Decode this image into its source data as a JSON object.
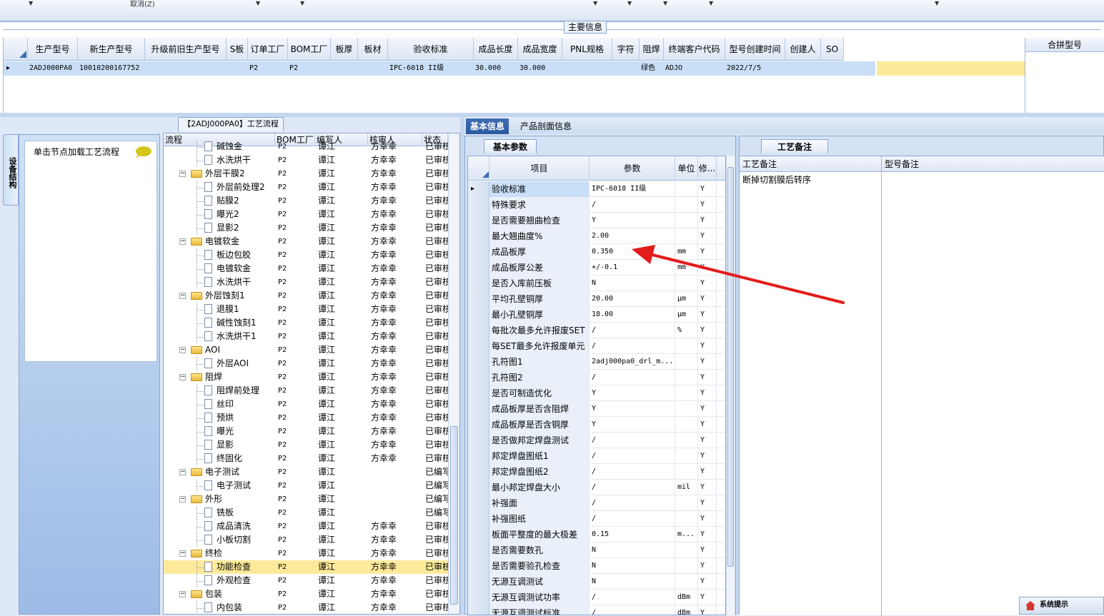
{
  "toolbar": {
    "cancel_label": "取消(Z)"
  },
  "main_info": {
    "title": "主要信息",
    "columns": [
      "生产型号",
      "新生产型号",
      "升级前旧生产型号",
      "S板",
      "订单工厂",
      "BOM工厂",
      "板厚",
      "板材",
      "验收标准",
      "成品长度",
      "成品宽度",
      "PNL规格",
      "字符",
      "阻焊",
      "终端客户代码",
      "型号创建时间",
      "创建人",
      "SO"
    ],
    "row": [
      "2ADJ000PA0",
      "10010200167752",
      "",
      "",
      "P2",
      "P2",
      "",
      "",
      "IPC-6018 II级",
      "30.000",
      "30.000",
      "",
      "",
      "绿色",
      "ADJO",
      "2022/7/5",
      "",
      ""
    ],
    "merge_header": "合拼型号"
  },
  "left_panel": {
    "tab_label": "设备结构",
    "load_text": "单击节点加载工艺流程"
  },
  "flow": {
    "title": "【2ADJ000PA0】工艺流程",
    "columns": [
      "流程",
      "BOM工厂",
      "编写人",
      "核审人",
      "状态"
    ],
    "rows": [
      {
        "name": "碱蚀金",
        "level": 2,
        "type": "doc",
        "bom": "P2",
        "writer": "谭江",
        "reviewer": "方幸幸",
        "status": "已审核"
      },
      {
        "name": "水洗烘干",
        "level": 2,
        "type": "doc",
        "bom": "P2",
        "writer": "谭江",
        "reviewer": "方幸幸",
        "status": "已审核"
      },
      {
        "name": "外层干膜2",
        "level": 1,
        "type": "folder",
        "bom": "P2",
        "writer": "谭江",
        "reviewer": "方幸幸",
        "status": "已审核"
      },
      {
        "name": "外层前处理2",
        "level": 2,
        "type": "doc",
        "bom": "P2",
        "writer": "谭江",
        "reviewer": "方幸幸",
        "status": "已审核"
      },
      {
        "name": "贴膜2",
        "level": 2,
        "type": "doc",
        "bom": "P2",
        "writer": "谭江",
        "reviewer": "方幸幸",
        "status": "已审核"
      },
      {
        "name": "曝光2",
        "level": 2,
        "type": "doc",
        "bom": "P2",
        "writer": "谭江",
        "reviewer": "方幸幸",
        "status": "已审核"
      },
      {
        "name": "显影2",
        "level": 2,
        "type": "doc",
        "bom": "P2",
        "writer": "谭江",
        "reviewer": "方幸幸",
        "status": "已审核"
      },
      {
        "name": "电镀软金",
        "level": 1,
        "type": "folder",
        "bom": "P2",
        "writer": "谭江",
        "reviewer": "方幸幸",
        "status": "已审核"
      },
      {
        "name": "板边包胶",
        "level": 2,
        "type": "doc",
        "bom": "P2",
        "writer": "谭江",
        "reviewer": "方幸幸",
        "status": "已审核"
      },
      {
        "name": "电镀软金",
        "level": 2,
        "type": "doc",
        "bom": "P2",
        "writer": "谭江",
        "reviewer": "方幸幸",
        "status": "已审核"
      },
      {
        "name": "水洗烘干",
        "level": 2,
        "type": "doc",
        "bom": "P2",
        "writer": "谭江",
        "reviewer": "方幸幸",
        "status": "已审核"
      },
      {
        "name": "外层蚀刻1",
        "level": 1,
        "type": "folder",
        "bom": "P2",
        "writer": "谭江",
        "reviewer": "方幸幸",
        "status": "已审核"
      },
      {
        "name": "退膜1",
        "level": 2,
        "type": "doc",
        "bom": "P2",
        "writer": "谭江",
        "reviewer": "方幸幸",
        "status": "已审核"
      },
      {
        "name": "碱性蚀刻1",
        "level": 2,
        "type": "doc",
        "bom": "P2",
        "writer": "谭江",
        "reviewer": "方幸幸",
        "status": "已审核"
      },
      {
        "name": "水洗烘干1",
        "level": 2,
        "type": "doc",
        "bom": "P2",
        "writer": "谭江",
        "reviewer": "方幸幸",
        "status": "已审核"
      },
      {
        "name": "AOI",
        "level": 1,
        "type": "folder",
        "bom": "P2",
        "writer": "谭江",
        "reviewer": "方幸幸",
        "status": "已审核"
      },
      {
        "name": "外层AOI",
        "level": 2,
        "type": "doc",
        "bom": "P2",
        "writer": "谭江",
        "reviewer": "方幸幸",
        "status": "已审核"
      },
      {
        "name": "阻焊",
        "level": 1,
        "type": "folder",
        "bom": "P2",
        "writer": "谭江",
        "reviewer": "方幸幸",
        "status": "已审核"
      },
      {
        "name": "阻焊前处理",
        "level": 2,
        "type": "doc",
        "bom": "P2",
        "writer": "谭江",
        "reviewer": "方幸幸",
        "status": "已审核"
      },
      {
        "name": "丝印",
        "level": 2,
        "type": "doc",
        "bom": "P2",
        "writer": "谭江",
        "reviewer": "方幸幸",
        "status": "已审核"
      },
      {
        "name": "预烘",
        "level": 2,
        "type": "doc",
        "bom": "P2",
        "writer": "谭江",
        "reviewer": "方幸幸",
        "status": "已审核"
      },
      {
        "name": "曝光",
        "level": 2,
        "type": "doc",
        "bom": "P2",
        "writer": "谭江",
        "reviewer": "方幸幸",
        "status": "已审核"
      },
      {
        "name": "显影",
        "level": 2,
        "type": "doc",
        "bom": "P2",
        "writer": "谭江",
        "reviewer": "方幸幸",
        "status": "已审核"
      },
      {
        "name": "终固化",
        "level": 2,
        "type": "doc",
        "bom": "P2",
        "writer": "谭江",
        "reviewer": "方幸幸",
        "status": "已审核"
      },
      {
        "name": "电子测试",
        "level": 1,
        "type": "folder",
        "bom": "P2",
        "writer": "谭江",
        "reviewer": "",
        "status": "已编写"
      },
      {
        "name": "电子测试",
        "level": 2,
        "type": "doc",
        "bom": "P2",
        "writer": "谭江",
        "reviewer": "",
        "status": "已编写"
      },
      {
        "name": "外形",
        "level": 1,
        "type": "folder",
        "bom": "P2",
        "writer": "谭江",
        "reviewer": "",
        "status": "已编写"
      },
      {
        "name": "铣板",
        "level": 2,
        "type": "doc",
        "bom": "P2",
        "writer": "谭江",
        "reviewer": "",
        "status": "已编写"
      },
      {
        "name": "成品清洗",
        "level": 2,
        "type": "doc",
        "bom": "P2",
        "writer": "谭江",
        "reviewer": "方幸幸",
        "status": "已审核"
      },
      {
        "name": "小板切割",
        "level": 2,
        "type": "doc",
        "bom": "P2",
        "writer": "谭江",
        "reviewer": "方幸幸",
        "status": "已审核"
      },
      {
        "name": "终检",
        "level": 1,
        "type": "folder",
        "bom": "P2",
        "writer": "谭江",
        "reviewer": "方幸幸",
        "status": "已审核"
      },
      {
        "name": "功能检查",
        "level": 2,
        "type": "doc",
        "bom": "P2",
        "writer": "谭江",
        "reviewer": "方幸幸",
        "status": "已审核",
        "selected": true
      },
      {
        "name": "外观检查",
        "level": 2,
        "type": "doc",
        "bom": "P2",
        "writer": "谭江",
        "reviewer": "方幸幸",
        "status": "已审核"
      },
      {
        "name": "包装",
        "level": 1,
        "type": "folder",
        "bom": "P2",
        "writer": "谭江",
        "reviewer": "方幸幸",
        "status": "已审核"
      },
      {
        "name": "内包装",
        "level": 2,
        "type": "doc",
        "bom": "P2",
        "writer": "谭江",
        "reviewer": "方幸幸",
        "status": "已审核"
      }
    ]
  },
  "right_tabs": [
    "基本信息",
    "产品剖面信息"
  ],
  "basic": {
    "tab": "基本参数",
    "columns": [
      "项目",
      "参数",
      "单位",
      "修..."
    ],
    "rows": [
      {
        "item": "验收标准",
        "value": "IPC-6018 II级",
        "unit": "",
        "mod": "Y",
        "selected": true
      },
      {
        "item": "特殊要求",
        "value": "/",
        "unit": "",
        "mod": "Y"
      },
      {
        "item": "是否需要翘曲检查",
        "value": "Y",
        "unit": "",
        "mod": "Y"
      },
      {
        "item": "最大翘曲度%",
        "value": "2.00",
        "unit": "",
        "mod": "Y"
      },
      {
        "item": "成品板厚",
        "value": "0.350",
        "unit": "mm",
        "mod": "Y"
      },
      {
        "item": "成品板厚公差",
        "value": "+/-0.1",
        "unit": "mm",
        "mod": "Y"
      },
      {
        "item": "是否入库前压板",
        "value": "N",
        "unit": "",
        "mod": "Y"
      },
      {
        "item": "平均孔壁铜厚",
        "value": "20.00",
        "unit": "μm",
        "mod": "Y"
      },
      {
        "item": "最小孔壁铜厚",
        "value": "18.00",
        "unit": "μm",
        "mod": "Y"
      },
      {
        "item": "每批次最多允许报废SET",
        "value": "/",
        "unit": "%",
        "mod": "Y"
      },
      {
        "item": "每SET最多允许报废单元",
        "value": "/",
        "unit": "",
        "mod": "Y"
      },
      {
        "item": "孔符图1",
        "value": "2adj000pa0_drl_m...",
        "unit": "",
        "mod": "Y"
      },
      {
        "item": "孔符图2",
        "value": "/",
        "unit": "",
        "mod": "Y"
      },
      {
        "item": "是否可制造优化",
        "value": "Y",
        "unit": "",
        "mod": "Y"
      },
      {
        "item": "成品板厚是否含阻焊",
        "value": "Y",
        "unit": "",
        "mod": "Y"
      },
      {
        "item": "成品板厚是否含铜厚",
        "value": "Y",
        "unit": "",
        "mod": "Y"
      },
      {
        "item": "是否做邦定焊盘测试",
        "value": "/",
        "unit": "",
        "mod": "Y"
      },
      {
        "item": "邦定焊盘图纸1",
        "value": "/",
        "unit": "",
        "mod": "Y"
      },
      {
        "item": "邦定焊盘图纸2",
        "value": "/",
        "unit": "",
        "mod": "Y"
      },
      {
        "item": "最小邦定焊盘大小",
        "value": "/",
        "unit": "mil",
        "mod": "Y"
      },
      {
        "item": "补强面",
        "value": "/",
        "unit": "",
        "mod": "Y"
      },
      {
        "item": "补强图纸",
        "value": "/",
        "unit": "",
        "mod": "Y"
      },
      {
        "item": "板面平整度的最大极差",
        "value": "0.15",
        "unit": "m...",
        "mod": "Y"
      },
      {
        "item": "是否需要数孔",
        "value": "N",
        "unit": "",
        "mod": "Y"
      },
      {
        "item": "是否需要验孔检查",
        "value": "N",
        "unit": "",
        "mod": "Y"
      },
      {
        "item": "无源互调测试",
        "value": "N",
        "unit": "",
        "mod": "Y"
      },
      {
        "item": "无源互调测试功率",
        "value": "/",
        "unit": "dBm",
        "mod": "Y"
      },
      {
        "item": "无源互调测试标准",
        "value": "/",
        "unit": "dBm",
        "mod": "Y"
      }
    ]
  },
  "remark": {
    "tab": "工艺备注",
    "craft_header": "工艺备注",
    "model_header": "型号备注",
    "craft_text": "断掉切割膜后转序"
  },
  "sys_tip": "系统提示",
  "colors": {
    "selected_yellow": "#fde99a",
    "selected_blue": "#c9dff7",
    "annotation_arrow": "#e31b1b"
  }
}
